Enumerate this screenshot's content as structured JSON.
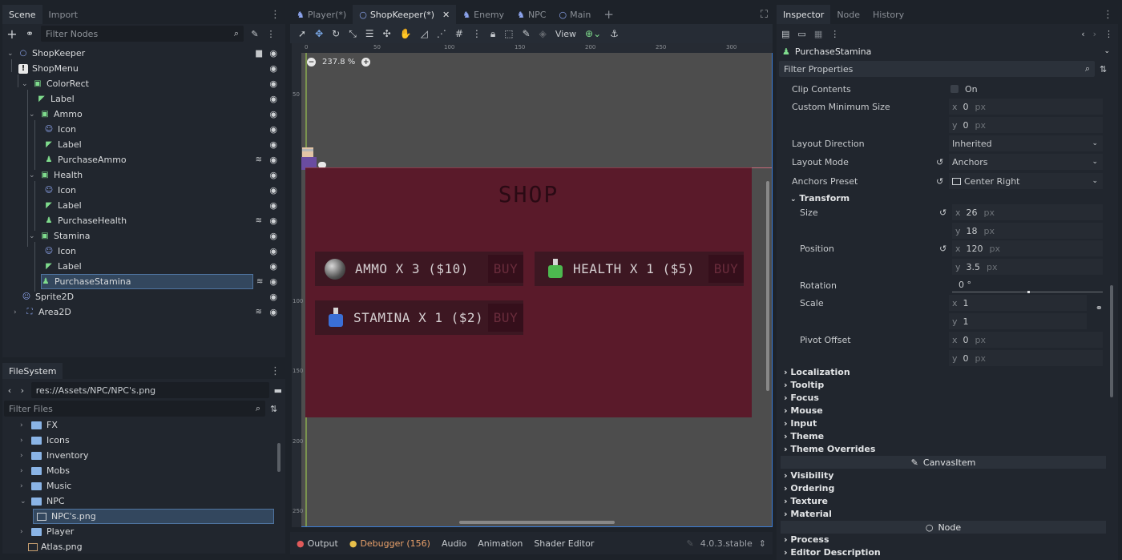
{
  "scene_dock": {
    "tabs": [
      "Scene",
      "Import"
    ],
    "filter_placeholder": "Filter Nodes",
    "nodes": [
      {
        "name": "ShopKeeper",
        "icon": "node2d-icon"
      },
      {
        "name": "ShopMenu",
        "icon": "control-warning-icon"
      },
      {
        "name": "ColorRect",
        "icon": "colorrect-icon"
      },
      {
        "name": "Label",
        "icon": "label-icon"
      },
      {
        "name": "Ammo",
        "icon": "colorrect-icon"
      },
      {
        "name": "Icon",
        "icon": "sprite-icon"
      },
      {
        "name": "Label",
        "icon": "label-icon"
      },
      {
        "name": "PurchaseAmmo",
        "icon": "button-icon"
      },
      {
        "name": "Health",
        "icon": "colorrect-icon"
      },
      {
        "name": "Icon",
        "icon": "sprite-icon"
      },
      {
        "name": "Label",
        "icon": "label-icon"
      },
      {
        "name": "PurchaseHealth",
        "icon": "button-icon"
      },
      {
        "name": "Stamina",
        "icon": "colorrect-icon"
      },
      {
        "name": "Icon",
        "icon": "sprite-icon"
      },
      {
        "name": "Label",
        "icon": "label-icon"
      },
      {
        "name": "PurchaseStamina",
        "icon": "button-icon"
      },
      {
        "name": "Sprite2D",
        "icon": "sprite2d-icon"
      },
      {
        "name": "Area2D",
        "icon": "area2d-icon"
      }
    ]
  },
  "filesystem": {
    "title": "FileSystem",
    "path": "res://Assets/NPC/NPC's.png",
    "filter_placeholder": "Filter Files",
    "items": [
      "FX",
      "Icons",
      "Inventory",
      "Mobs",
      "Music",
      "NPC",
      "NPC's.png",
      "Player",
      "Atlas.png"
    ]
  },
  "editor": {
    "tabs": [
      "Player(*)",
      "ShopKeeper(*)",
      "Enemy",
      "NPC",
      "Main"
    ],
    "view_label": "View",
    "zoom": "237.8 %",
    "ruler_h": [
      "0",
      "50",
      "100",
      "150",
      "200",
      "250",
      "300"
    ],
    "ruler_v": [
      "50",
      "100",
      "150",
      "200",
      "250"
    ],
    "shop_title": "SHOP",
    "items": [
      {
        "label": "AMMO X 3 ($10)",
        "buy": "BUY"
      },
      {
        "label": "HEALTH X 1 ($5)",
        "buy": "BUY"
      },
      {
        "label": "STAMINA X 1 ($2)",
        "buy": "BUY"
      }
    ],
    "bottom_tabs": [
      "Output",
      "Debugger (156)",
      "Audio",
      "Animation",
      "Shader Editor"
    ],
    "version": "4.0.3.stable"
  },
  "inspector": {
    "tabs": [
      "Inspector",
      "Node",
      "History"
    ],
    "selected_node": "PurchaseStamina",
    "filter_placeholder": "Filter Properties",
    "clip_contents_label": "Clip Contents",
    "clip_contents_value": "On",
    "custom_min_size_label": "Custom Minimum Size",
    "custom_min_x": "0",
    "custom_min_y": "0",
    "unit_px": "px",
    "layout_direction_label": "Layout Direction",
    "layout_direction": "Inherited",
    "layout_mode_label": "Layout Mode",
    "layout_mode": "Anchors",
    "anchors_preset_label": "Anchors Preset",
    "anchors_preset": "Center Right",
    "transform_label": "Transform",
    "size_label": "Size",
    "size_x": "26",
    "size_y": "18",
    "position_label": "Position",
    "position_x": "120",
    "position_y": "3.5",
    "rotation_label": "Rotation",
    "rotation_value": "0 °",
    "scale_label": "Scale",
    "scale_x": "1",
    "scale_y": "1",
    "pivot_label": "Pivot Offset",
    "pivot_x": "0",
    "pivot_y": "0",
    "sections": [
      "Localization",
      "Tooltip",
      "Focus",
      "Mouse",
      "Input",
      "Theme",
      "Theme Overrides"
    ],
    "canvas_item_label": "CanvasItem",
    "canvas_sections": [
      "Visibility",
      "Ordering",
      "Texture",
      "Material"
    ],
    "node_label": "Node",
    "node_sections": [
      "Process",
      "Editor Description"
    ]
  },
  "colors": {
    "accent": "#4f74a0",
    "panel_bg": "#21262e",
    "viewport_bg": "#4d4d4d",
    "shop_bg": "#5a1a2a",
    "item_bg": "#3d1722"
  }
}
